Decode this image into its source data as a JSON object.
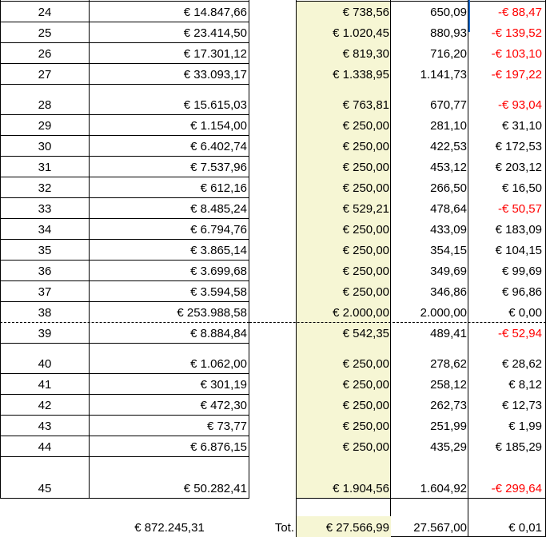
{
  "colors": {
    "fee_column_bg": "#f6f6d4",
    "negative_text": "#ff0000",
    "selection_border": "#1f6fd1"
  },
  "rows": [
    {
      "id": "24",
      "amount": "€ 14.847,66",
      "fee": "€ 738,56",
      "value": "650,09",
      "diff": "-€ 88,47",
      "neg": true
    },
    {
      "id": "25",
      "amount": "€ 23.414,50",
      "fee": "€ 1.020,45",
      "value": "880,93",
      "diff": "-€ 139,52",
      "neg": true
    },
    {
      "id": "26",
      "amount": "€ 17.301,12",
      "fee": "€ 819,30",
      "value": "716,20",
      "diff": "-€ 103,10",
      "neg": true
    },
    {
      "id": "27",
      "amount": "€ 33.093,17",
      "fee": "€ 1.338,95",
      "value": "1.141,73",
      "diff": "-€ 197,22",
      "neg": true
    },
    {
      "id": "28",
      "amount": "€ 15.615,03",
      "fee": "€ 763,81",
      "value": "670,77",
      "diff": "-€ 93,04",
      "neg": true
    },
    {
      "id": "29",
      "amount": "€ 1.154,00",
      "fee": "€ 250,00",
      "value": "281,10",
      "diff": "€ 31,10",
      "neg": false
    },
    {
      "id": "30",
      "amount": "€ 6.402,74",
      "fee": "€ 250,00",
      "value": "422,53",
      "diff": "€ 172,53",
      "neg": false
    },
    {
      "id": "31",
      "amount": "€ 7.537,96",
      "fee": "€ 250,00",
      "value": "453,12",
      "diff": "€ 203,12",
      "neg": false
    },
    {
      "id": "32",
      "amount": "€ 612,16",
      "fee": "€ 250,00",
      "value": "266,50",
      "diff": "€ 16,50",
      "neg": false
    },
    {
      "id": "33",
      "amount": "€ 8.485,24",
      "fee": "€ 529,21",
      "value": "478,64",
      "diff": "-€ 50,57",
      "neg": true
    },
    {
      "id": "34",
      "amount": "€ 6.794,76",
      "fee": "€ 250,00",
      "value": "433,09",
      "diff": "€ 183,09",
      "neg": false
    },
    {
      "id": "35",
      "amount": "€ 3.865,14",
      "fee": "€ 250,00",
      "value": "354,15",
      "diff": "€ 104,15",
      "neg": false
    },
    {
      "id": "36",
      "amount": "€ 3.699,68",
      "fee": "€ 250,00",
      "value": "349,69",
      "diff": "€ 99,69",
      "neg": false
    },
    {
      "id": "37",
      "amount": "€ 3.594,58",
      "fee": "€ 250,00",
      "value": "346,86",
      "diff": "€ 96,86",
      "neg": false
    },
    {
      "id": "38",
      "amount": "€ 253.988,58",
      "fee": "€ 2.000,00",
      "value": "2.000,00",
      "diff": "€ 0,00",
      "neg": false
    },
    {
      "id": "39",
      "amount": "€ 8.884,84",
      "fee": "€ 542,35",
      "value": "489,41",
      "diff": "-€ 52,94",
      "neg": true
    },
    {
      "id": "40",
      "amount": "€ 1.062,00",
      "fee": "€ 250,00",
      "value": "278,62",
      "diff": "€ 28,62",
      "neg": false
    },
    {
      "id": "41",
      "amount": "€ 301,19",
      "fee": "€ 250,00",
      "value": "258,12",
      "diff": "€ 8,12",
      "neg": false
    },
    {
      "id": "42",
      "amount": "€ 472,30",
      "fee": "€ 250,00",
      "value": "262,73",
      "diff": "€ 12,73",
      "neg": false
    },
    {
      "id": "43",
      "amount": "€ 73,77",
      "fee": "€ 250,00",
      "value": "251,99",
      "diff": "€ 1,99",
      "neg": false
    },
    {
      "id": "44",
      "amount": "€ 6.876,15",
      "fee": "€ 250,00",
      "value": "435,29",
      "diff": "€ 185,29",
      "neg": false
    },
    {
      "id": "45",
      "amount": "€ 50.282,41",
      "fee": "€ 1.904,56",
      "value": "1.604,92",
      "diff": "-€ 299,64",
      "neg": true
    }
  ],
  "totals": {
    "amount": "€ 872.245,31",
    "label": "Tot.",
    "fee": "€ 27.566,99",
    "value": "27.567,00",
    "diff": "€ 0,01"
  }
}
